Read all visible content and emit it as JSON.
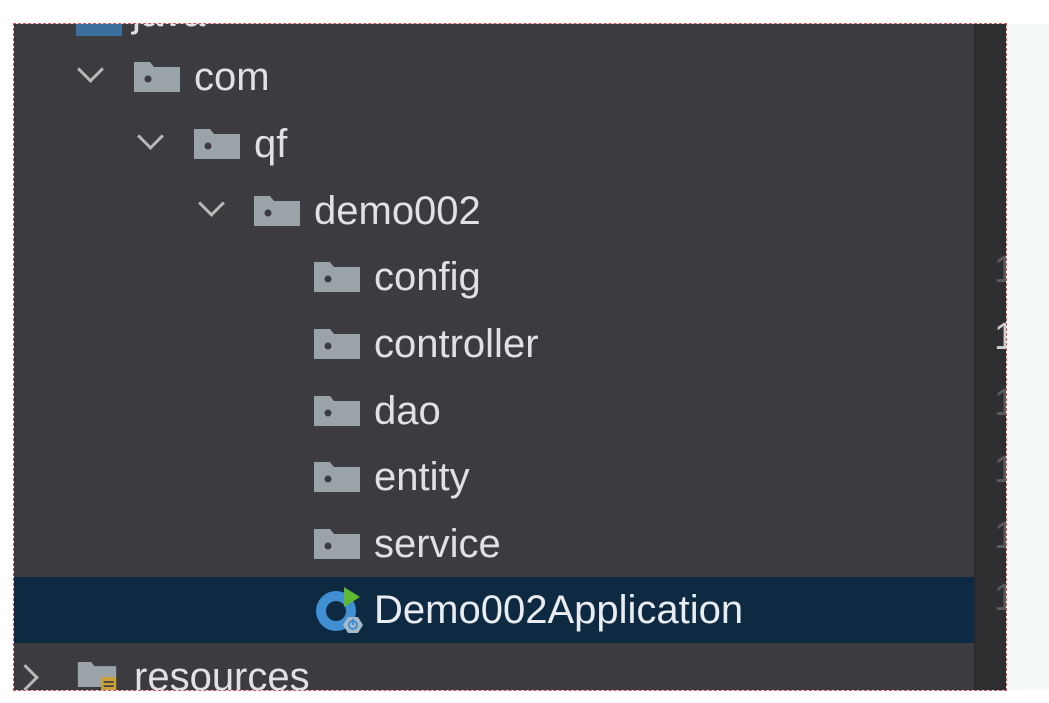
{
  "tree": {
    "partial_top_label": "java",
    "items": [
      {
        "label": "com",
        "expanded": true
      },
      {
        "label": "qf",
        "expanded": true
      },
      {
        "label": "demo002",
        "expanded": true
      },
      {
        "label": "config"
      },
      {
        "label": "controller"
      },
      {
        "label": "dao"
      },
      {
        "label": "entity"
      },
      {
        "label": "service"
      },
      {
        "label": "Demo002Application",
        "selected": true,
        "icon": "spring-boot-run-icon"
      },
      {
        "label": "resources",
        "expanded": false,
        "icon": "resources-folder-icon"
      }
    ]
  },
  "gutter": {
    "line_numbers": [
      "1",
      "1",
      "1",
      "1",
      "1",
      "1"
    ]
  },
  "colors": {
    "panel_bg": "#3c3b3f",
    "selection_bg": "#0e2a42",
    "folder_gray": "#9aa3a8",
    "text": "#dfe1e5",
    "spring_green": "#5fb832",
    "spring_blue": "#3f8fd2"
  }
}
